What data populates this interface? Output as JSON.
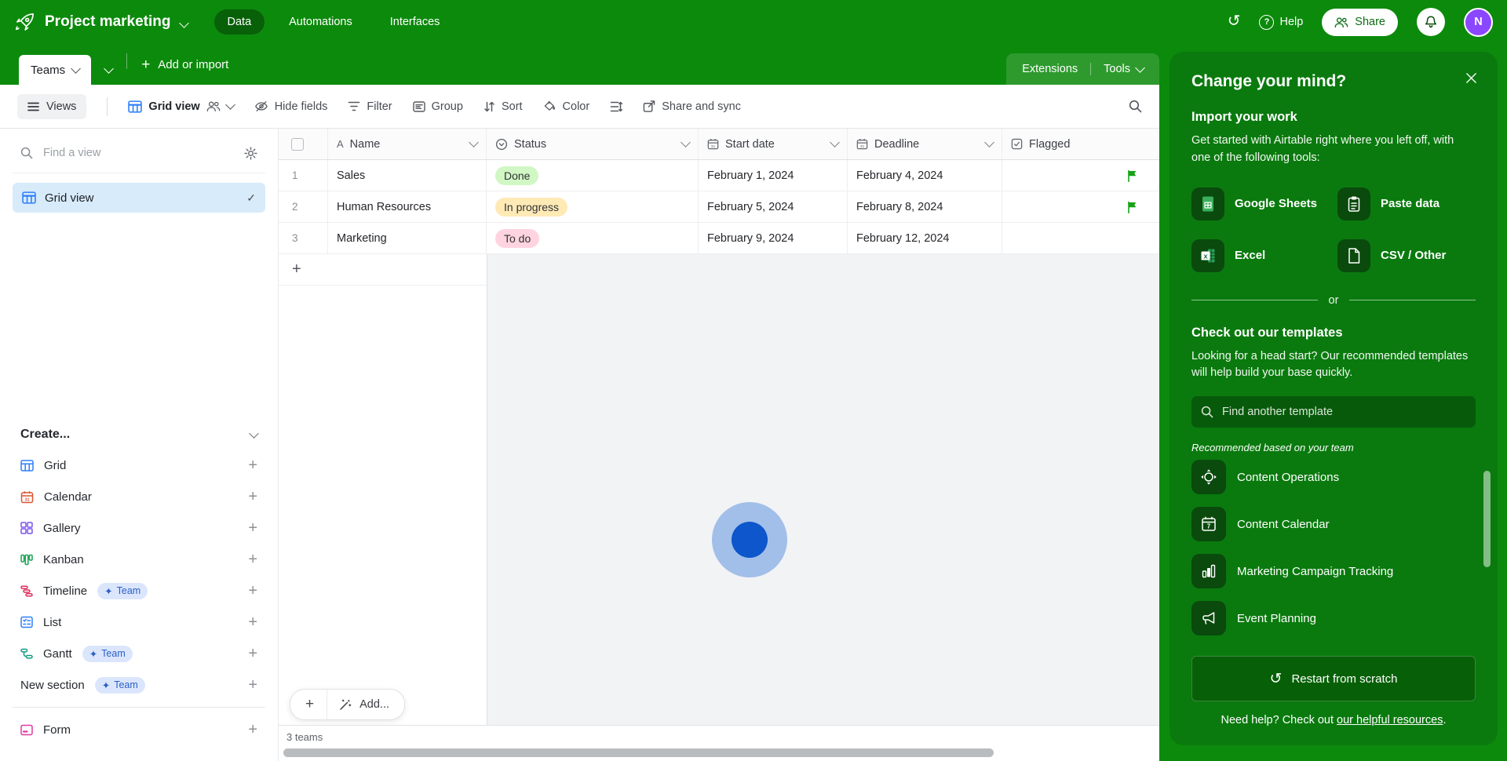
{
  "glyphs": {
    "plus": "+",
    "history": "↺",
    "check": "✓",
    "question": "?",
    "sparkle": "✦",
    "field_text": "A"
  },
  "colors": {
    "brand_green": "#0c8a0c",
    "panel_green": "#0a7a0e",
    "tile_green": "#0a4a0d",
    "button_green": "#076007",
    "accent_blue": "#2d7ff9",
    "selected_view_bg": "#d8ebfa",
    "avatar_purple": "#8b46ff",
    "flag_green": "#15a215",
    "status_done_bg": "#d1f7c4",
    "status_inprogress_bg": "#ffeab6",
    "status_todo_bg": "#ffd4e0",
    "click_outer": "#a2bfe9",
    "click_inner": "#0d56cb"
  },
  "header": {
    "base_name": "Project marketing",
    "tabs": [
      {
        "label": "Data"
      },
      {
        "label": "Automations"
      },
      {
        "label": "Interfaces"
      }
    ],
    "help_label": "Help",
    "share_label": "Share",
    "avatar_initial": "N"
  },
  "table_bar": {
    "active_table": "Teams",
    "add_label": "Add or import",
    "extensions_label": "Extensions",
    "tools_label": "Tools"
  },
  "view_bar": {
    "views_label": "Views",
    "view_name": "Grid view",
    "tools": [
      "Hide fields",
      "Filter",
      "Group",
      "Sort",
      "Color",
      "Share and sync"
    ]
  },
  "sidebar": {
    "search_placeholder": "Find a view",
    "selected_view": "Grid view",
    "create_label": "Create...",
    "badge_label": "Team",
    "items": [
      {
        "label": "Grid"
      },
      {
        "label": "Calendar"
      },
      {
        "label": "Gallery"
      },
      {
        "label": "Kanban"
      },
      {
        "label": "Timeline",
        "badge": "Team"
      },
      {
        "label": "List"
      },
      {
        "label": "Gantt",
        "badge": "Team"
      },
      {
        "label": "New section",
        "badge": "Team"
      },
      {
        "label": "Form"
      }
    ]
  },
  "table": {
    "columns": [
      {
        "label": "Name"
      },
      {
        "label": "Status"
      },
      {
        "label": "Start date"
      },
      {
        "label": "Deadline"
      },
      {
        "label": "Flagged"
      }
    ],
    "rows": [
      {
        "num": "1",
        "name": "Sales",
        "status": "Done",
        "status_bg": "#d1f7c4",
        "start": "February 1, 2024",
        "deadline": "February 4, 2024",
        "flagged": true
      },
      {
        "num": "2",
        "name": "Human Resources",
        "status": "In progress",
        "status_bg": "#ffeab6",
        "start": "February 5, 2024",
        "deadline": "February 8, 2024",
        "flagged": true
      },
      {
        "num": "3",
        "name": "Marketing",
        "status": "To do",
        "status_bg": "#ffd4e0",
        "start": "February 9, 2024",
        "deadline": "February 12, 2024",
        "flagged": false
      }
    ],
    "add_row_label": "Add...",
    "footer_count": "3 teams"
  },
  "panel": {
    "title": "Change your mind?",
    "import": {
      "heading": "Import your work",
      "body": "Get started with Airtable right where you left off, with one of the following tools:",
      "options": [
        {
          "label": "Google Sheets"
        },
        {
          "label": "Paste data"
        },
        {
          "label": "Excel"
        },
        {
          "label": "CSV / Other"
        }
      ]
    },
    "divider_label": "or",
    "templates": {
      "heading": "Check out our templates",
      "body": "Looking for a head start? Our recommended templates will help build your base quickly.",
      "search_placeholder": "Find another template",
      "recommended_label": "Recommended based on your team",
      "items": [
        {
          "label": "Content Operations"
        },
        {
          "label": "Content Calendar"
        },
        {
          "label": "Marketing Campaign Tracking"
        },
        {
          "label": "Event Planning"
        }
      ]
    },
    "restart_label": "Restart from scratch",
    "help_prefix": "Need help? Check out ",
    "help_link": "our helpful resources",
    "help_suffix": "."
  }
}
